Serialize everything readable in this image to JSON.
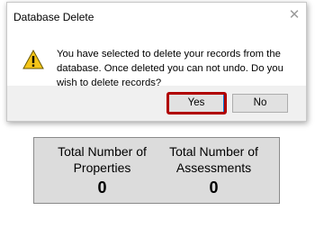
{
  "dialog": {
    "title": "Database Delete",
    "message": "You have selected to delete your records from the database. Once deleted you can not undo. Do you wish to delete records?",
    "icon": "warning-icon",
    "buttons": {
      "yes": "Yes",
      "no": "No"
    },
    "highlight_color": "#b00000"
  },
  "stats": {
    "properties": {
      "label": "Total Number of Properties",
      "value": "0"
    },
    "assessments": {
      "label": "Total Number of Assessments",
      "value": "0"
    }
  }
}
